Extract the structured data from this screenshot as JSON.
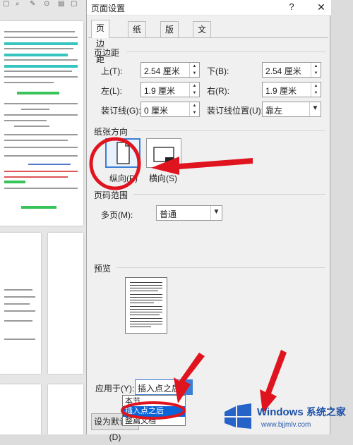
{
  "dialog": {
    "title": "页面设置",
    "help": "?",
    "close": "✕",
    "tabs": [
      "页边距",
      "纸张",
      "版式",
      "文档网格"
    ],
    "margins": {
      "group_title": "页边距",
      "top_label": "上(T):",
      "top_value": "2.54 厘米",
      "bottom_label": "下(B):",
      "bottom_value": "2.54 厘米",
      "left_label": "左(L):",
      "left_value": "1.9 厘米",
      "right_label": "右(R):",
      "right_value": "1.9 厘米",
      "gutter_label": "装订线(G):",
      "gutter_value": "0 厘米",
      "gutter_pos_label": "装订线位置(U):",
      "gutter_pos_value": "靠左"
    },
    "orientation": {
      "group_title": "纸张方向",
      "portrait": "纵向(P)",
      "landscape": "横向(S)",
      "selected": "portrait"
    },
    "pages": {
      "group_title": "页码范围",
      "multiple_label": "多页(M):",
      "multiple_value": "普通"
    },
    "preview": {
      "group_title": "预览"
    },
    "apply": {
      "label": "应用于(Y):",
      "value": "插入点之后",
      "options": [
        "本节",
        "插入点之后",
        "整篇文档"
      ],
      "selected_option": "插入点之后"
    },
    "default_button": "设为默认值(D)"
  },
  "watermark": {
    "brand": "Windows",
    "brand_cn": "系统之家",
    "url": "www.bjjmlv.com"
  },
  "colors": {
    "annotation_red": "#e0141e",
    "selection_blue": "#0a64d8"
  },
  "icons": [
    "portrait-page-icon",
    "landscape-page-icon",
    "windows-logo-icon"
  ]
}
